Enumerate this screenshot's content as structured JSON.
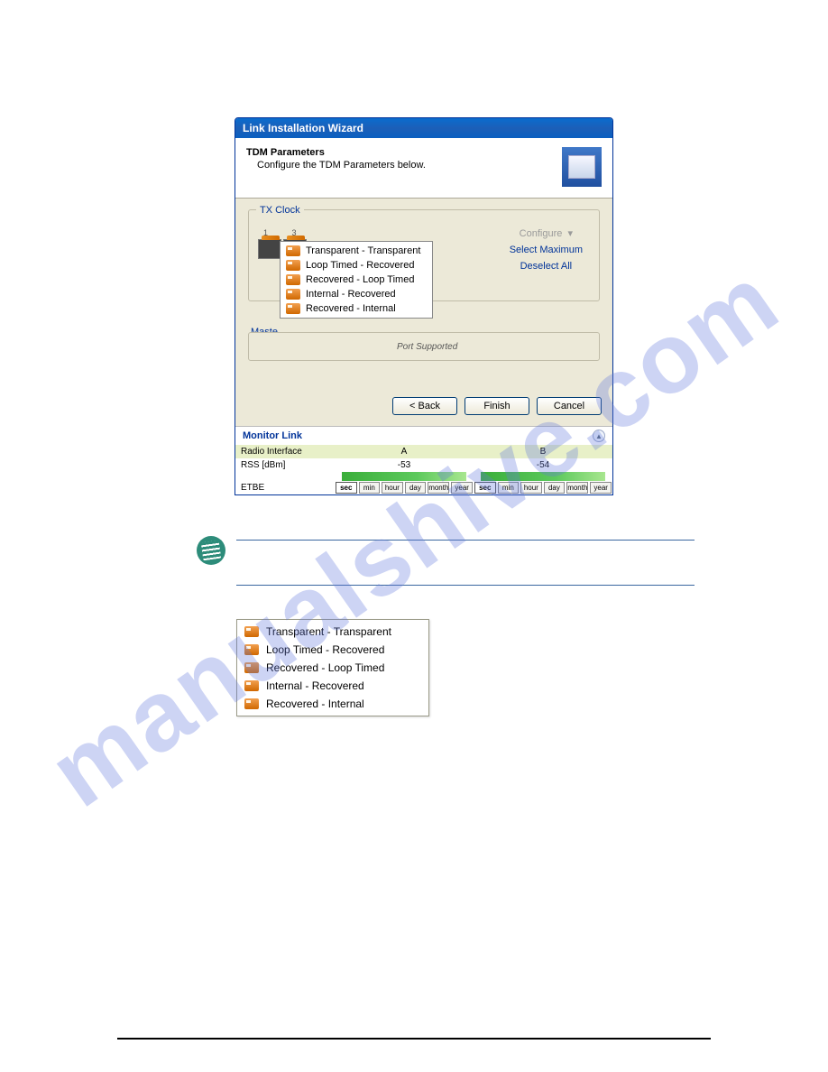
{
  "watermark": "manualshive.com",
  "wizard": {
    "title": "Link Installation Wizard",
    "header": {
      "title": "TDM Parameters",
      "subtitle": "Configure the TDM Parameters below."
    },
    "txclock": {
      "legend": "TX Clock",
      "port_numbers": "1   3",
      "options": [
        "Transparent - Transparent",
        "Loop Timed - Recovered",
        "Recovered - Loop Timed",
        "Internal - Recovered",
        "Recovered - Internal"
      ],
      "configure": "Configure",
      "select_max": "Select Maximum",
      "deselect_all": "Deselect All"
    },
    "master": {
      "label": "Maste",
      "text": "Port Supported"
    },
    "buttons": {
      "back": "< Back",
      "finish": "Finish",
      "cancel": "Cancel"
    },
    "monitor": {
      "title": "Monitor Link",
      "radio_if": "Radio Interface",
      "col_a": "A",
      "col_b": "B",
      "rss_label": "RSS [dBm]",
      "rss_a": "-53",
      "rss_b": "-54",
      "etbe": "ETBE",
      "timescale": [
        "sec",
        "min",
        "hour",
        "day",
        "month",
        "year"
      ]
    }
  },
  "lone_list": {
    "items": [
      "Transparent - Transparent",
      "Loop Timed - Recovered",
      "Recovered - Loop Timed",
      "Internal - Recovered",
      "Recovered - Internal"
    ]
  }
}
